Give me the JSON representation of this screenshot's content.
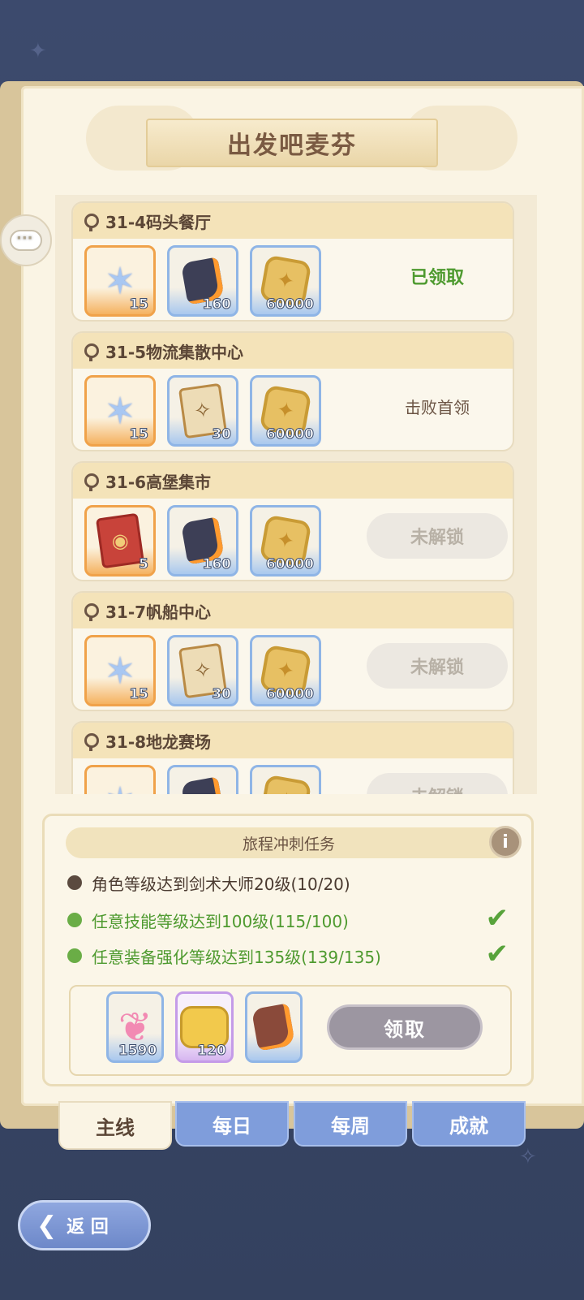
{
  "page_title": "出发吧麦芬",
  "quests": [
    {
      "title": "31-4码头餐厅",
      "rewards": [
        {
          "icon": "blue-crystal-icon",
          "style": "orange",
          "qty": "15"
        },
        {
          "icon": "dark-ore-icon",
          "style": "blue",
          "qty": "160"
        },
        {
          "icon": "gold-coin-icon",
          "style": "blue",
          "qty": "60000"
        }
      ],
      "status": "已领取",
      "status_type": "claimed"
    },
    {
      "title": "31-5物流集散中心",
      "rewards": [
        {
          "icon": "blue-crystal-icon",
          "style": "orange",
          "qty": "15"
        },
        {
          "icon": "skill-scroll-icon",
          "style": "blue",
          "qty": "30"
        },
        {
          "icon": "gold-coin-icon",
          "style": "blue",
          "qty": "60000"
        }
      ],
      "status": "击败首领",
      "status_type": "defeat"
    },
    {
      "title": "31-6高堡集市",
      "rewards": [
        {
          "icon": "red-card-icon",
          "style": "orange",
          "qty": "5"
        },
        {
          "icon": "dark-ore-icon",
          "style": "blue",
          "qty": "160"
        },
        {
          "icon": "gold-coin-icon",
          "style": "blue",
          "qty": "60000"
        }
      ],
      "status": "未解锁",
      "status_type": "locked"
    },
    {
      "title": "31-7帆船中心",
      "rewards": [
        {
          "icon": "blue-crystal-icon",
          "style": "orange",
          "qty": "15"
        },
        {
          "icon": "skill-scroll-icon",
          "style": "blue",
          "qty": "30"
        },
        {
          "icon": "gold-coin-icon",
          "style": "blue",
          "qty": "60000"
        }
      ],
      "status": "未解锁",
      "status_type": "locked"
    },
    {
      "title": "31-8地龙赛场",
      "rewards": [
        {
          "icon": "blue-crystal-icon",
          "style": "orange",
          "qty": ""
        },
        {
          "icon": "dark-ore-icon",
          "style": "blue",
          "qty": ""
        },
        {
          "icon": "gold-coin-icon",
          "style": "blue",
          "qty": ""
        }
      ],
      "status": "未解锁",
      "status_type": "locked"
    }
  ],
  "sprint": {
    "title": "旅程冲刺任务",
    "info": "i",
    "tasks": [
      {
        "text": "角色等级达到剑术大师20级(10/20)",
        "done": false
      },
      {
        "text": "任意技能等级达到100级(115/100)",
        "done": true
      },
      {
        "text": "任意装备强化等级达到135级(139/135)",
        "done": true
      }
    ],
    "rewards": [
      {
        "icon": "pink-paw-icon",
        "style": "blue",
        "qty": "1590"
      },
      {
        "icon": "bread-icon",
        "style": "purple",
        "qty": "120"
      },
      {
        "icon": "partial-item-icon",
        "style": "blue",
        "qty": ""
      }
    ],
    "claim_label": "领取"
  },
  "tabs": [
    "主线",
    "每日",
    "每周",
    "成就"
  ],
  "back_label": "返 回",
  "check_mark": "✔"
}
